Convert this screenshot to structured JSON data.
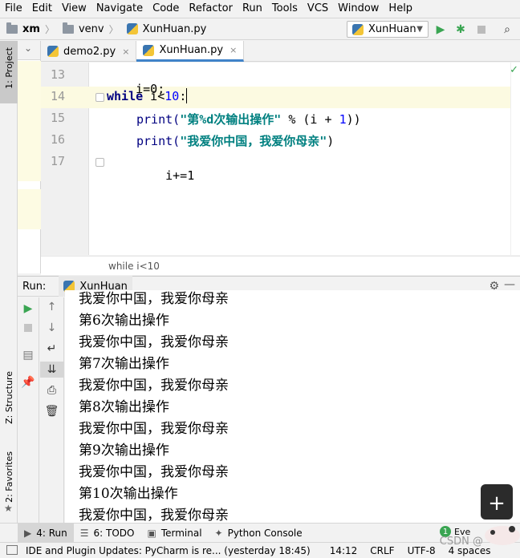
{
  "menu": [
    "File",
    "Edit",
    "View",
    "Navigate",
    "Code",
    "Refactor",
    "Run",
    "Tools",
    "VCS",
    "Window",
    "Help"
  ],
  "nav": {
    "project": "xm",
    "folder": "venv",
    "file": "XunHuan.py",
    "run_config": "XunHuan"
  },
  "tabs": [
    {
      "label": "demo2.py",
      "close": "×"
    },
    {
      "label": "XunHuan.py",
      "close": "×"
    }
  ],
  "editor": {
    "line_numbers": [
      "13",
      "14",
      "15",
      "16",
      "17"
    ],
    "lines": {
      "l13": "i=0;",
      "l14_kw": "while",
      "l14_rest": " i<",
      "l14_num": "10",
      "l14_end": ":",
      "l15_fn": "print(",
      "l15_str": "\"第%d次输出操作\"",
      "l15_rest": " % (i + ",
      "l15_num": "1",
      "l15_end": "))",
      "l16_fn": "print(",
      "l16_str": "\"我爱你中国，我爱你母亲\"",
      "l16_end": ")",
      "l17": "i+=1"
    },
    "breadcrumb": "while i<10"
  },
  "left_strip": {
    "project": "1: Project",
    "structure": "Z: Structure",
    "favorites": "2: Favorites"
  },
  "run": {
    "label": "Run:",
    "tab": "XunHuan",
    "output": [
      "我爱你中国，我爱你母亲",
      "第6次输出操作",
      "我爱你中国，我爱你母亲",
      "第7次输出操作",
      "我爱你中国，我爱你母亲",
      "第8次输出操作",
      "我爱你中国，我爱你母亲",
      "第9次输出操作",
      "我爱你中国，我爱你母亲",
      "第10次输出操作",
      "我爱你中国，我爱你母亲"
    ]
  },
  "bottom_tabs": [
    {
      "label": "4: Run"
    },
    {
      "label": "6: TODO"
    },
    {
      "label": "Terminal"
    },
    {
      "label": "Python Console"
    }
  ],
  "event_log": {
    "count": "1",
    "label": "Eve"
  },
  "status": {
    "message": "IDE and Plugin Updates: PyCharm is re... (yesterday 18:45)",
    "position": "14:12",
    "line_sep": "CRLF",
    "encoding": "UTF-8",
    "indent": "4 spaces"
  },
  "watermark": "CSDN @",
  "colors": {
    "keyword": "#000080",
    "string": "#008080",
    "number": "#0000ff",
    "run_green": "#3aa552",
    "accent_tab": "#4083c9",
    "current_line": "#fcfae1"
  }
}
